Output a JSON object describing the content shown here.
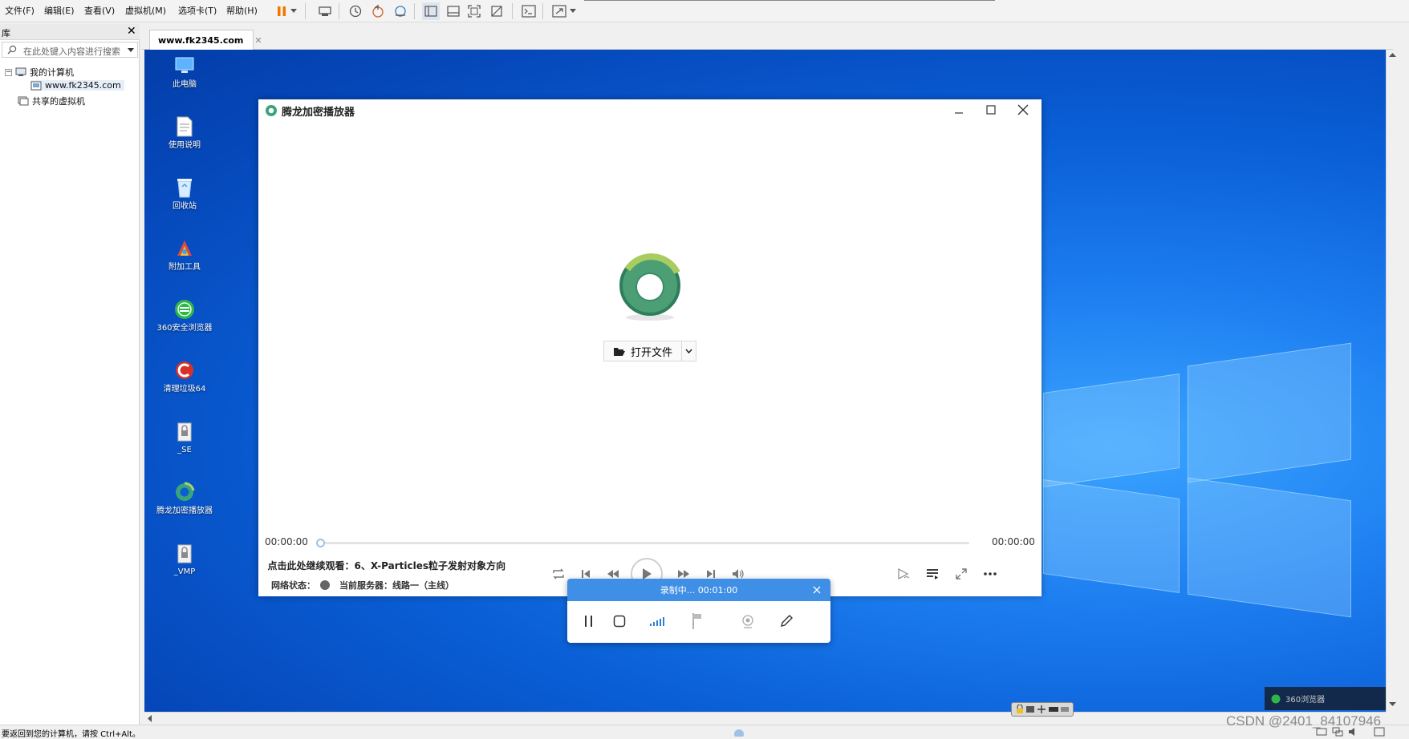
{
  "menubar": {
    "items": [
      "文件(F)",
      "编辑(E)",
      "查看(V)",
      "虚拟机(M)",
      "选项卡(T)",
      "帮助(H)"
    ],
    "accent_pause": "#f07800"
  },
  "library": {
    "title": "库",
    "search_placeholder": "在此处键入内容进行搜索",
    "tree": {
      "my_computer": "我的计算机",
      "vm_name": "www.fk2345.com",
      "shared": "共享的虚拟机"
    }
  },
  "tab": {
    "label": "www.fk2345.com"
  },
  "desktop": {
    "icons": [
      {
        "label": "此电脑",
        "icon": "computer-icon"
      },
      {
        "label": "使用说明",
        "icon": "document-icon"
      },
      {
        "label": "回收站",
        "icon": "recycle-bin-icon"
      },
      {
        "label": "附加工具",
        "icon": "tools-icon"
      },
      {
        "label": "360安全浏览器",
        "icon": "browser-360-icon"
      },
      {
        "label": "清理垃圾64",
        "icon": "ccleaner-icon"
      },
      {
        "label": "_SE",
        "icon": "lock-file-icon"
      },
      {
        "label": "腾龙加密播放器",
        "icon": "player-icon"
      },
      {
        "label": "_VMP",
        "icon": "lock-file-icon"
      }
    ],
    "background": "#0a5fd6"
  },
  "player": {
    "title": "腾龙加密播放器",
    "open_file": "打开文件",
    "time_current": "00:00:00",
    "time_total": "00:00:00",
    "progress": 0,
    "continue_watch": "点击此处继续观看：6、X-Particles粒子发射对象方向",
    "network_label": "网络状态：",
    "server_label": "当前服务器：线路一（主线）",
    "brand_color": "#3ba37a"
  },
  "recorder": {
    "status": "录制中... 00:01:00",
    "header_color": "#3f8fe6"
  },
  "statusbar": {
    "text": "要返回到您的计算机，请按 Ctrl+Alt。"
  },
  "taskbar": {
    "browser_label": "360浏览器"
  },
  "watermark": "CSDN @2401_84107946"
}
